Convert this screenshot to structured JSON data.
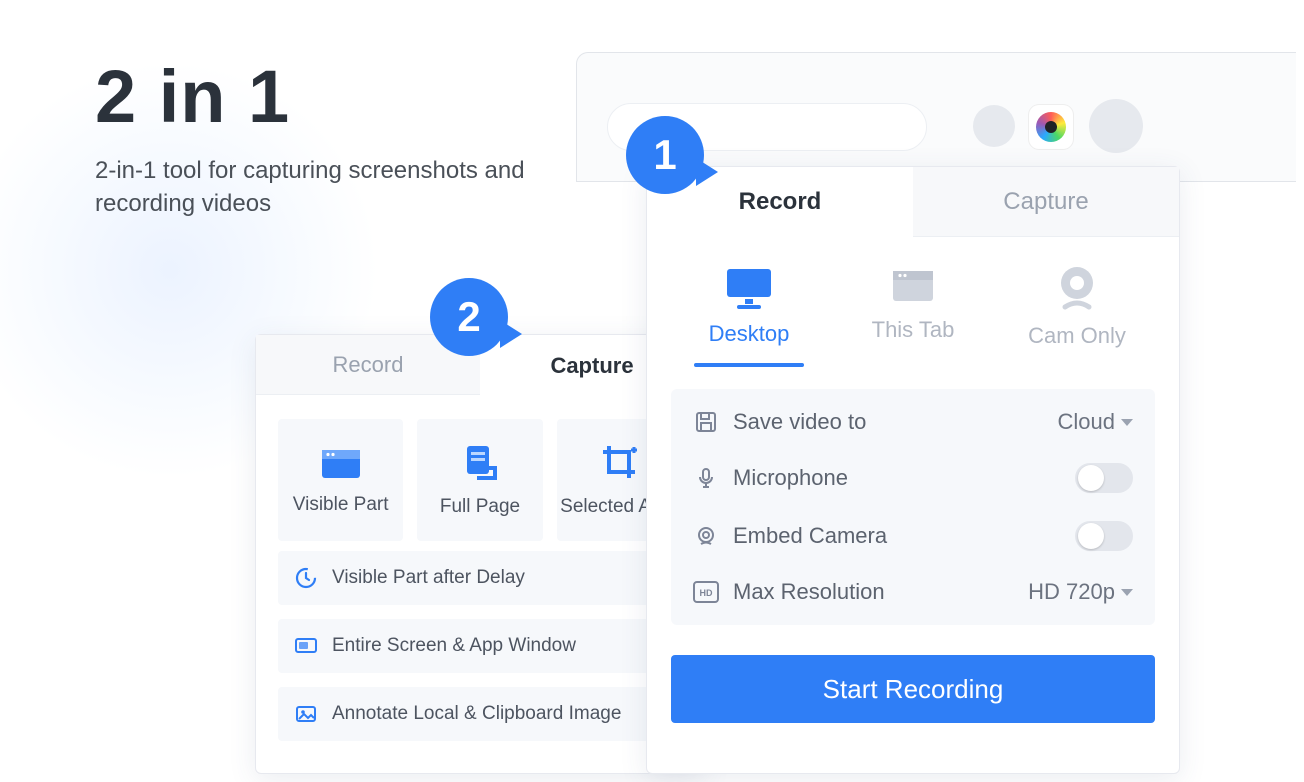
{
  "headline": {
    "title": "2 in 1",
    "subtitle": "2-in-1 tool for capturing screenshots and recording videos"
  },
  "bubbles": {
    "one": "1",
    "two": "2"
  },
  "record_popup": {
    "tabs": {
      "record": "Record",
      "capture": "Capture"
    },
    "sources": {
      "desktop": "Desktop",
      "this_tab": "This Tab",
      "cam_only": "Cam Only"
    },
    "settings": {
      "save_to_label": "Save video to",
      "save_to_value": "Cloud",
      "mic_label": "Microphone",
      "camera_label": "Embed Camera",
      "res_label": "Max Resolution",
      "res_value": "HD 720p"
    },
    "start_button": "Start Recording"
  },
  "capture_popup": {
    "tabs": {
      "record": "Record",
      "capture": "Capture"
    },
    "tiles": {
      "visible_part": "Visible Part",
      "full_page": "Full Page",
      "selected_area": "Selected Area"
    },
    "list": {
      "visible_delay": "Visible Part after Delay",
      "entire_screen": "Entire Screen & App Window",
      "annotate": "Annotate Local & Clipboard Image"
    }
  }
}
